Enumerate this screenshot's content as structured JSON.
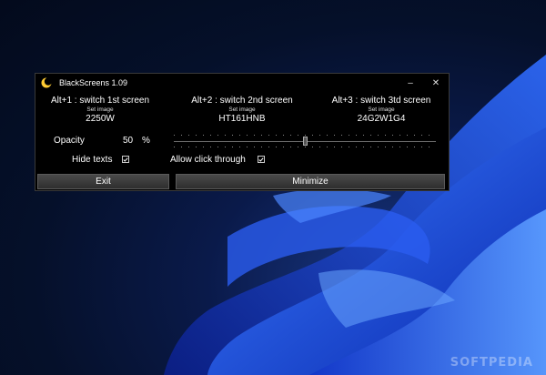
{
  "window": {
    "title": "BlackScreens 1.09",
    "minimize_glyph": "–",
    "close_glyph": "✕"
  },
  "screens": [
    {
      "hotkey": "Alt+1 : switch 1st screen",
      "set_image": "Set image",
      "monitor": "2250W"
    },
    {
      "hotkey": "Alt+2 : switch 2nd screen",
      "set_image": "Set image",
      "monitor": "HT161HNB"
    },
    {
      "hotkey": "Alt+3 : switch 3td screen",
      "set_image": "Set image",
      "monitor": "24G2W1G4"
    }
  ],
  "opacity": {
    "label": "Opacity",
    "value": "50",
    "unit": "%",
    "slider_fraction": 0.5
  },
  "options": {
    "hide_texts_label": "Hide texts",
    "hide_texts_checked": true,
    "click_through_label": "Allow click through",
    "click_through_checked": true
  },
  "buttons": {
    "exit": "Exit",
    "minimize": "Minimize"
  },
  "watermark": "SOFTPEDIA",
  "colors": {
    "window_bg": "#000000",
    "wallpaper_accent": "#1e5bff"
  },
  "icons": {
    "app": "moon-icon",
    "checkmark": "checkmark-icon"
  }
}
